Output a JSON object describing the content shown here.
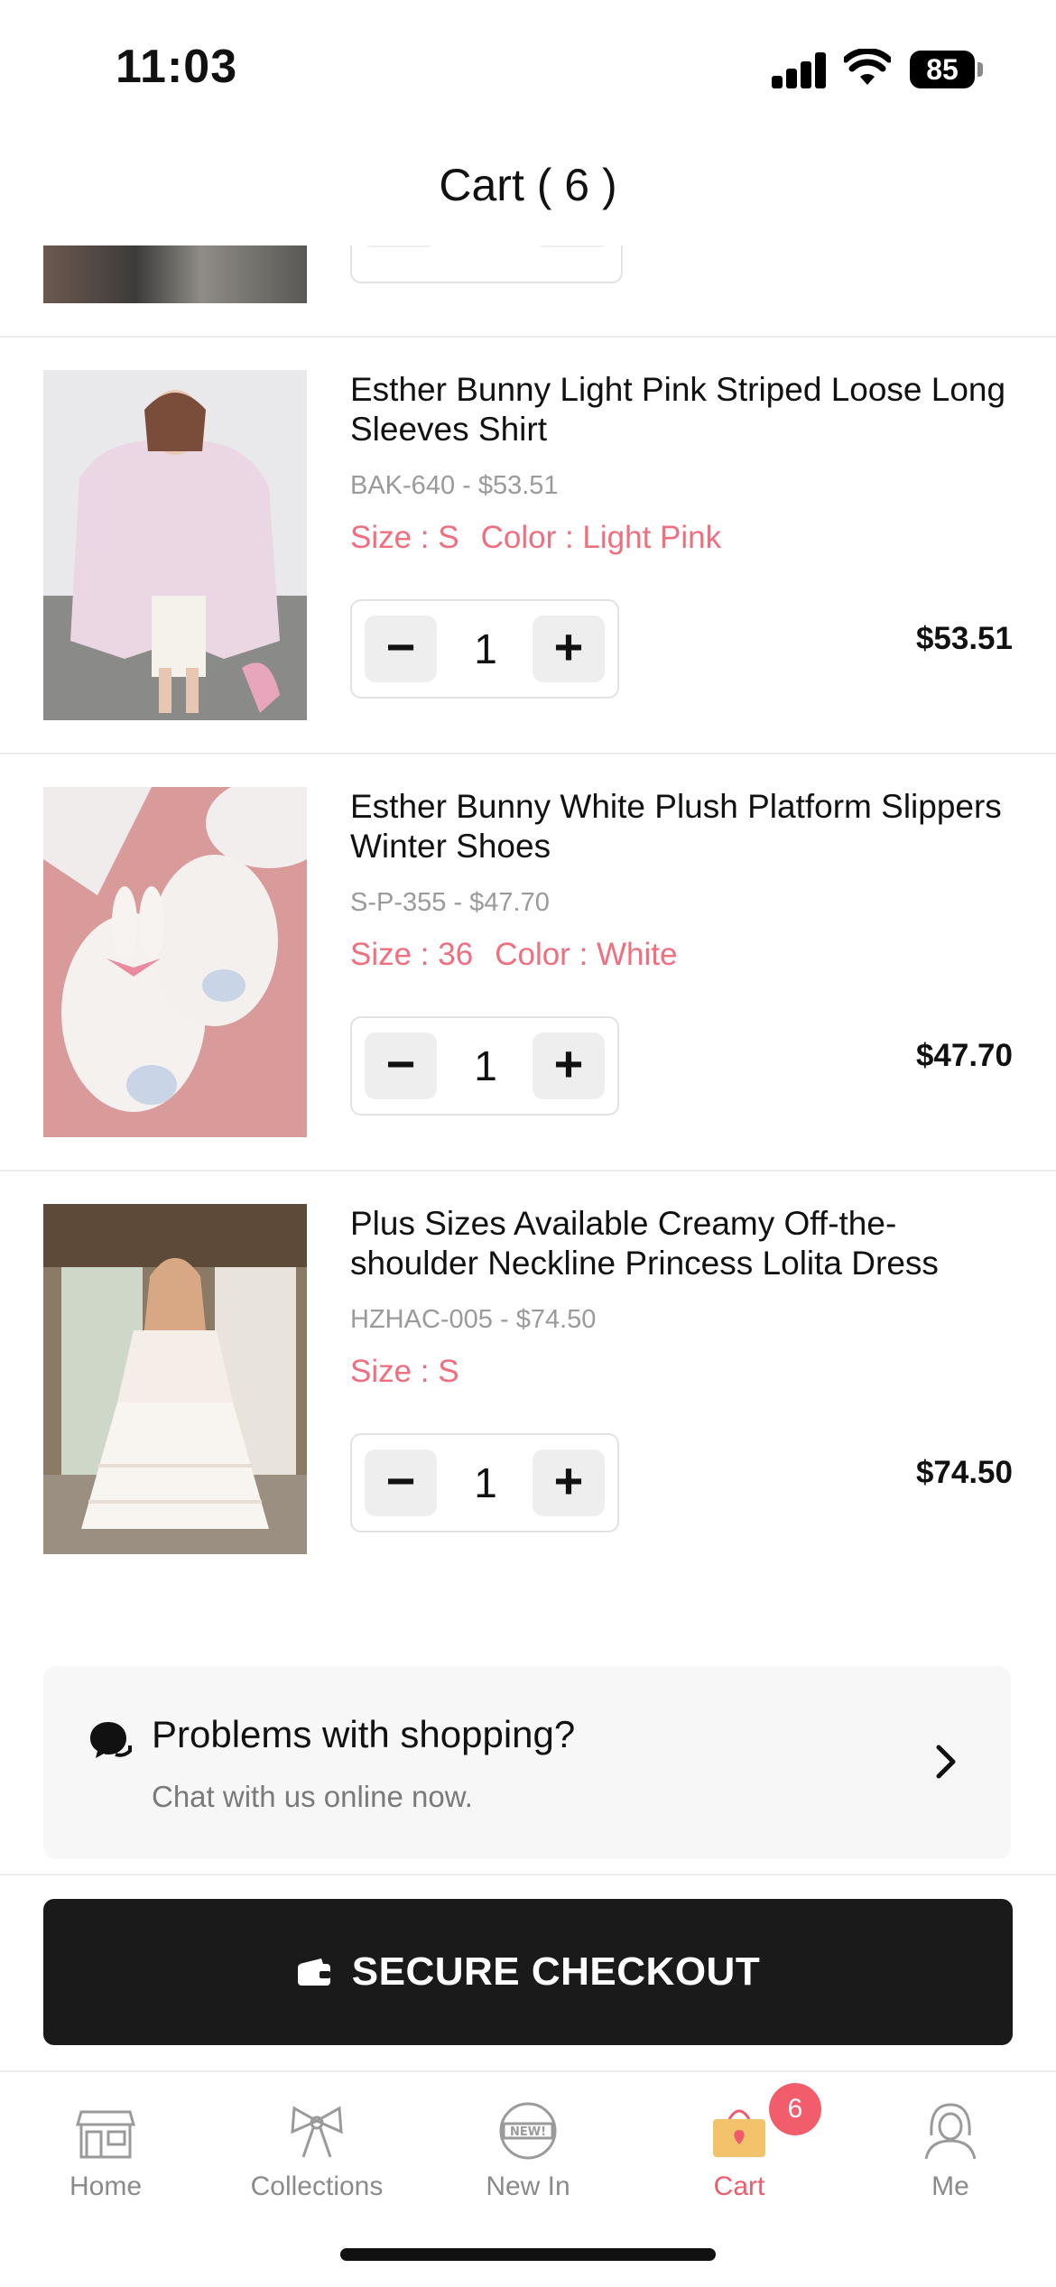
{
  "status_bar": {
    "time": "11:03",
    "battery": "85"
  },
  "header": {
    "title": "Cart ( 6 )"
  },
  "items": [
    {
      "name": "Esther Bunny Light Pink Striped Loose Long Sleeves Shirt",
      "sku_price": "BAK-640 - $53.51",
      "size": "Size : S",
      "color": "Color : Light Pink",
      "quantity": "1",
      "price": "$53.51"
    },
    {
      "name": "Esther Bunny White Plush Platform Slippers Winter Shoes",
      "sku_price": "S-P-355 - $47.70",
      "size": "Size : 36",
      "color": "Color : White",
      "quantity": "1",
      "price": "$47.70"
    },
    {
      "name": "Plus Sizes Available Creamy Off-the-shoulder Neckline Princess Lolita Dress",
      "sku_price": "HZHAC-005 - $74.50",
      "size": "Size : S",
      "color": "",
      "quantity": "1",
      "price": "$74.50"
    }
  ],
  "stepper": {
    "minus": "−",
    "plus": "+"
  },
  "help": {
    "title": "Problems with shopping?",
    "subtitle": "Chat with us online now."
  },
  "checkout": {
    "label": "SECURE CHECKOUT"
  },
  "tabs": [
    {
      "label": "Home",
      "icon": "storefront-icon"
    },
    {
      "label": "Collections",
      "icon": "bow-icon"
    },
    {
      "label": "New In",
      "icon": "new-badge-icon"
    },
    {
      "label": "Cart",
      "icon": "shopping-bag-icon",
      "badge": "6"
    },
    {
      "label": "Me",
      "icon": "profile-icon"
    }
  ],
  "colors": {
    "accent": "#ef5b6a",
    "checkout_bg": "#1a1a1a"
  }
}
